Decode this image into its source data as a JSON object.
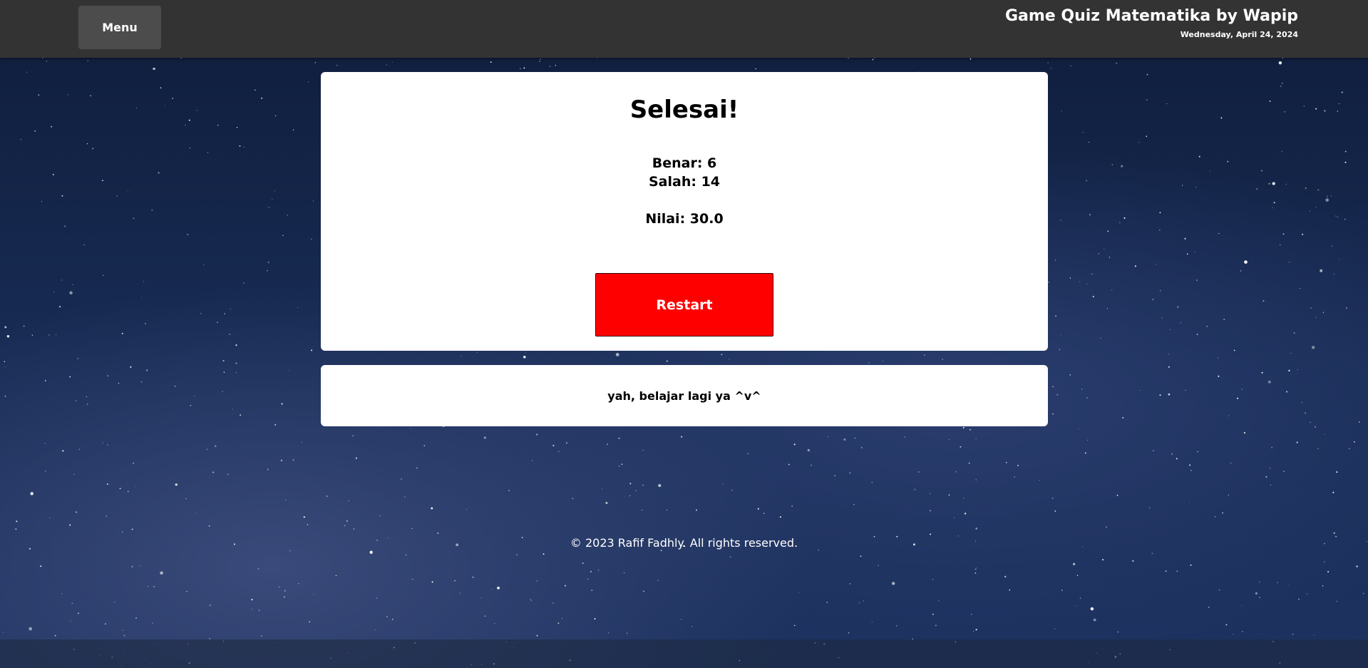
{
  "header": {
    "menu_label": "Menu",
    "title": "Game Quiz Matematika by Wapip",
    "date": "Wednesday, April 24, 2024"
  },
  "result": {
    "title": "Selesai!",
    "benar": "Benar: 6",
    "salah": "Salah: 14",
    "nilai": "Nilai: 30.0",
    "restart_label": "Restart"
  },
  "message": {
    "text": "yah, belajar lagi ya ^v^"
  },
  "footer": {
    "copyright": "© 2023 Rafif Fadhly. All rights reserved."
  },
  "colors": {
    "header_bg": "#333333",
    "menu_button_bg": "#4c4c4c",
    "restart_button_bg": "#ff0000",
    "card_bg": "#ffffff",
    "background": "#182c55"
  }
}
